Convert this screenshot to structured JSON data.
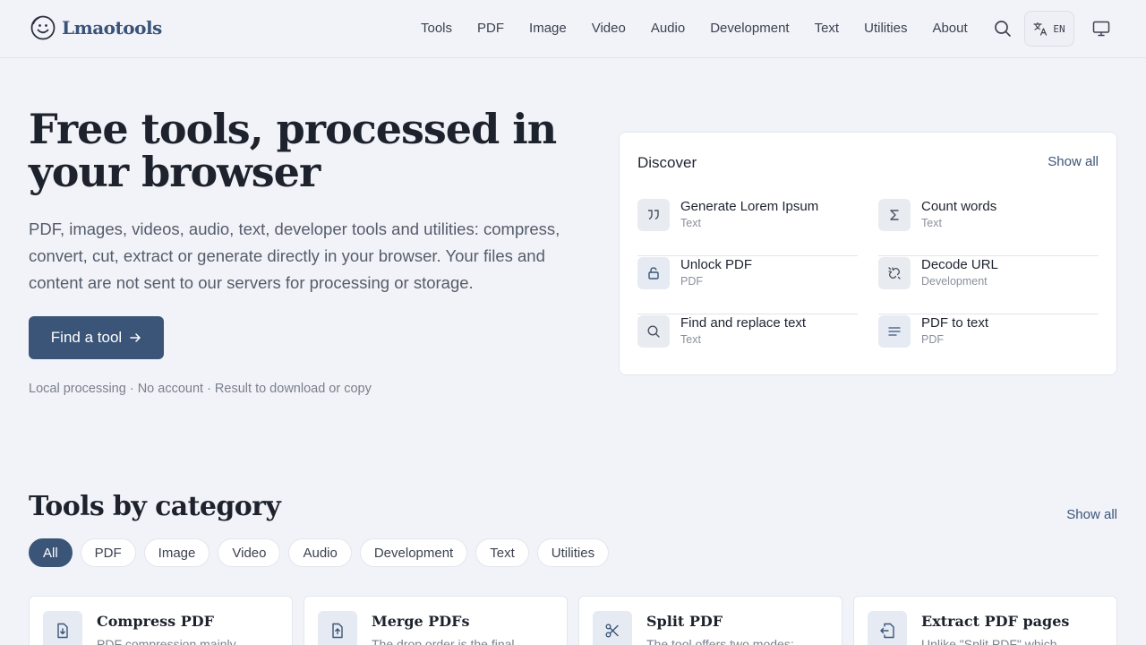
{
  "header": {
    "logo_text": "Lmaotools",
    "nav": [
      "Tools",
      "PDF",
      "Image",
      "Video",
      "Audio",
      "Development",
      "Text",
      "Utilities",
      "About"
    ],
    "lang_label": "EN",
    "icons": [
      "search-icon",
      "translate-icon",
      "monitor-icon"
    ]
  },
  "hero": {
    "title": "Free tools, processed in your browser",
    "description": "PDF, images, videos, audio, text, developer tools and utilities: compress, convert, cut, extract or generate directly in your browser. Your files and content are not sent to our servers for processing or storage.",
    "cta_label": "Find a tool",
    "meta": "Local processing · No account · Result to download or copy"
  },
  "discover": {
    "title": "Discover",
    "show_all": "Show all",
    "items": [
      {
        "name": "Generate Lorem Ipsum",
        "category": "Text",
        "icon": "quote-icon"
      },
      {
        "name": "Count words",
        "category": "Text",
        "icon": "sigma-icon"
      },
      {
        "name": "Unlock PDF",
        "category": "PDF",
        "icon": "unlock-icon"
      },
      {
        "name": "Decode URL",
        "category": "Development",
        "icon": "link-broken-icon"
      },
      {
        "name": "Find and replace text",
        "category": "Text",
        "icon": "search-icon"
      },
      {
        "name": "PDF to text",
        "category": "PDF",
        "icon": "text-lines-icon"
      }
    ]
  },
  "categories": {
    "title": "Tools by category",
    "show_all": "Show all",
    "chips": [
      "All",
      "PDF",
      "Image",
      "Video",
      "Audio",
      "Development",
      "Text",
      "Utilities"
    ],
    "active_chip": "All"
  },
  "tools": [
    {
      "name": "Compress PDF",
      "desc": "PDF compression mainly",
      "icon": "file-download-icon"
    },
    {
      "name": "Merge PDFs",
      "desc": "The drop order is the final",
      "icon": "file-upload-icon"
    },
    {
      "name": "Split PDF",
      "desc": "The tool offers two modes:",
      "icon": "scissors-icon"
    },
    {
      "name": "Extract PDF pages",
      "desc": "Unlike \"Split PDF\" which",
      "icon": "file-export-icon"
    }
  ],
  "colors": {
    "accent": "#3b5578",
    "background": "#f1f3f8",
    "card": "#ffffff"
  }
}
